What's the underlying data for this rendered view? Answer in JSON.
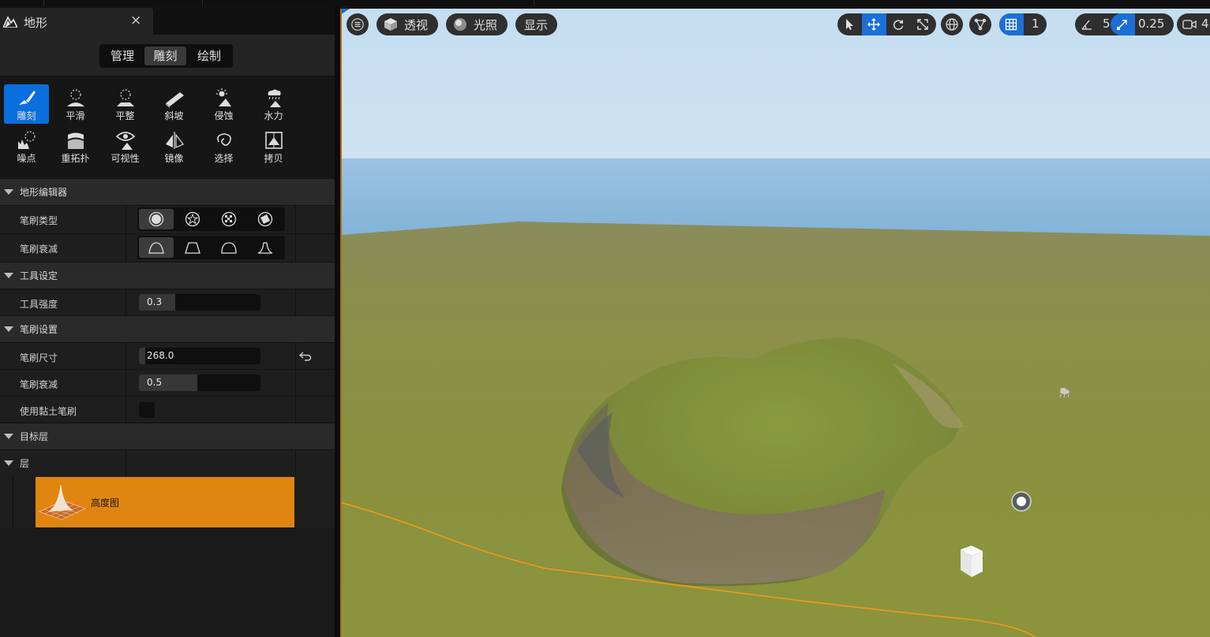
{
  "panel": {
    "tab_title": "地形",
    "close_glyph": "×",
    "modes": [
      "管理",
      "雕刻",
      "绘制"
    ],
    "active_mode": "雕刻",
    "tools_row1": [
      "雕刻",
      "平滑",
      "平整",
      "斜坡",
      "侵蚀",
      "水力"
    ],
    "tools_row2": [
      "噪点",
      "重拓扑",
      "可视性",
      "镜像",
      "选择",
      "拷贝"
    ],
    "active_tool": "雕刻",
    "sections": {
      "landscape_editor": "地形编辑器",
      "tool_settings": "工具设定",
      "brush_settings": "笔刷设置",
      "target_layers": "目标层",
      "layers": "层"
    },
    "props": {
      "brush_type": "笔刷类型",
      "brush_falloff": "笔刷衰减",
      "tool_strength": "工具强度",
      "tool_strength_value": "0.3",
      "brush_size": "笔刷尺寸",
      "brush_size_value": "268.0",
      "brush_falloff2": "笔刷衰减",
      "brush_falloff_value": "0.5",
      "use_clay_brush": "使用黏土笔刷"
    },
    "fills": {
      "tool_strength": 0.3,
      "brush_size": 0.05,
      "brush_falloff": 0.5
    },
    "layer_name": "高度图",
    "layer_color": "#e08510"
  },
  "viewport": {
    "menu_icon": "hamburger-icon",
    "perspective": "透视",
    "lighting": "光照",
    "show": "显示",
    "grid_value": "1",
    "angle_value": "5°",
    "scale_value": "0.25",
    "camera_value": "4",
    "accent": "#1b6fd6"
  }
}
